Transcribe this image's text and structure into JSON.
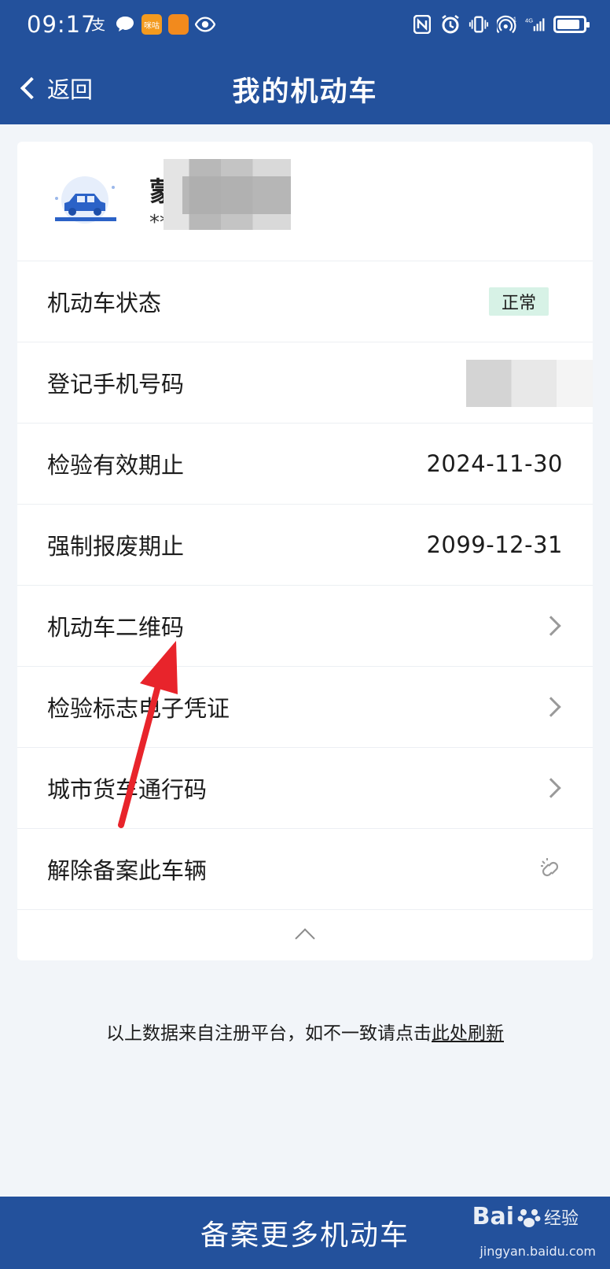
{
  "status_bar": {
    "time": "09:17",
    "icons_left": [
      "alipay-icon",
      "message-icon",
      "app-icon",
      "app-icon-2",
      "eye-icon"
    ],
    "icons_right": [
      "nfc-icon",
      "alarm-icon",
      "vibrate-icon",
      "hotspot-icon",
      "4g-signal-icon",
      "battery-icon"
    ]
  },
  "nav": {
    "back_label": "返回",
    "title": "我的机动车"
  },
  "vehicle": {
    "plate_prefix": "蒙",
    "plate_sub": "**"
  },
  "rows": [
    {
      "label": "机动车状态",
      "badge": "正常"
    },
    {
      "label": "登记手机号码",
      "value": ""
    },
    {
      "label": "检验有效期止",
      "value": "2024-11-30"
    },
    {
      "label": "强制报废期止",
      "value": "2099-12-31"
    },
    {
      "label": "机动车二维码"
    },
    {
      "label": "检验标志电子凭证"
    },
    {
      "label": "城市货车通行码"
    },
    {
      "label": "解除备案此车辆"
    }
  ],
  "footnote": {
    "text": "以上数据来自注册平台，如不一致请点击",
    "link": "此处刷新"
  },
  "bottom": {
    "button_label": "备案更多机动车"
  },
  "watermark": {
    "brand": "Bai",
    "suffix": "经验",
    "url": "jingyan.baidu.com"
  },
  "colors": {
    "primary": "#23519c",
    "badge_bg": "#d7f2e6",
    "arrow": "#e8242b"
  }
}
